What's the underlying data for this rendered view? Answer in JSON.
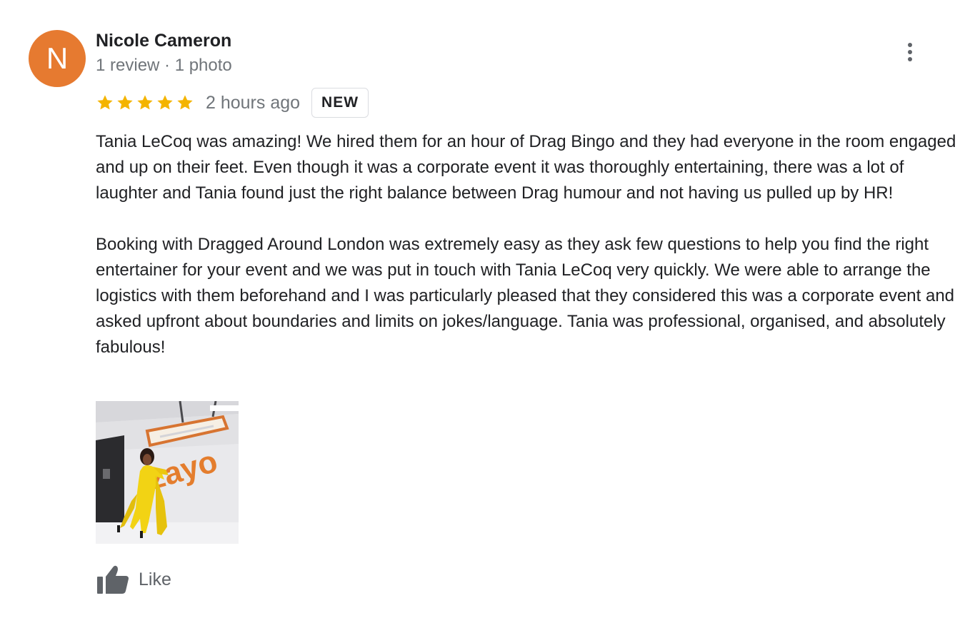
{
  "reviewer": {
    "initial": "N",
    "name": "Nicole Cameron",
    "meta": "1 review · 1 photo",
    "avatar_color": "#e67a30"
  },
  "more_menu_icon": "more-vert-icon",
  "rating": {
    "stars": 5,
    "max": 5,
    "star_color": "#f4b400",
    "time": "2 hours ago",
    "badge": "NEW"
  },
  "review": {
    "paragraphs": [
      "Tania LeCoq was amazing! We hired them for an hour of Drag Bingo and they had everyone in the room engaged and up on their feet. Even though it was a corporate event it was thoroughly entertaining, there was a lot of laughter and Tania found just the right balance between Drag humour and not having us pulled up by HR!",
      "Booking with Dragged Around London was extremely easy as they ask few questions to help you find the right entertainer for your event and we was put in touch with Tania LeCoq very quickly. We were able to arrange the logistics with them beforehand and I was particularly pleased that they considered this was a corporate event and asked upfront about boundaries and limits on jokes/language. Tania was professional, organised, and absolutely fabulous!"
    ]
  },
  "photo": {
    "sign_text": "zayo"
  },
  "actions": {
    "like_label": "Like",
    "like_icon": "thumbs-up-icon"
  }
}
